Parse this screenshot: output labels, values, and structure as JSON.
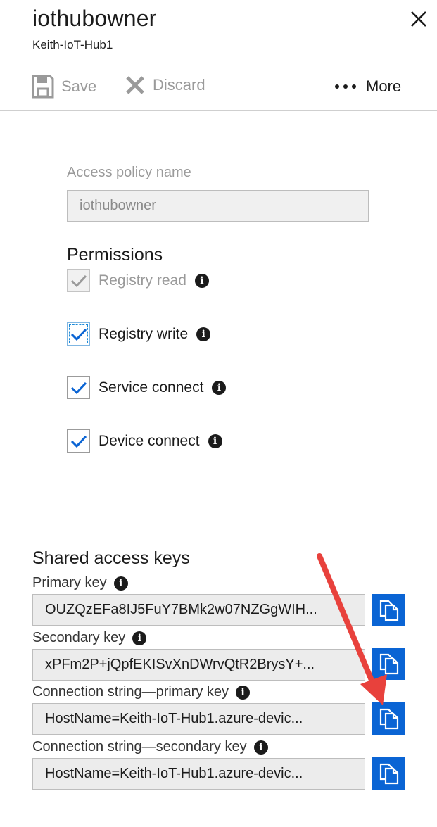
{
  "header": {
    "title": "iothubowner",
    "subtitle": "Keith-IoT-Hub1"
  },
  "toolbar": {
    "save_label": "Save",
    "discard_label": "Discard",
    "more_label": "More"
  },
  "policy": {
    "name_label": "Access policy name",
    "name_value": "iothubowner"
  },
  "permissions": {
    "title": "Permissions",
    "items": [
      {
        "label": "Registry read",
        "checked": true,
        "disabled": true
      },
      {
        "label": "Registry write",
        "checked": true,
        "disabled": false
      },
      {
        "label": "Service connect",
        "checked": true,
        "disabled": false
      },
      {
        "label": "Device connect",
        "checked": true,
        "disabled": false
      }
    ]
  },
  "keys": {
    "title": "Shared access keys",
    "items": [
      {
        "label": "Primary key",
        "value": "OUZQzEFa8IJ5FuY7BMk2w07NZGgWIH..."
      },
      {
        "label": "Secondary key",
        "value": "xPFm2P+jQpfEKISvXnDWrvQtR2BrysY+..."
      },
      {
        "label": "Connection string—primary key",
        "value": "HostName=Keith-IoT-Hub1.azure-devic..."
      },
      {
        "label": "Connection string—secondary key",
        "value": "HostName=Keith-IoT-Hub1.azure-devic..."
      }
    ]
  },
  "colors": {
    "accent": "#0a64d4",
    "annotation_arrow": "#e8413c",
    "check": "#0a64d4"
  }
}
